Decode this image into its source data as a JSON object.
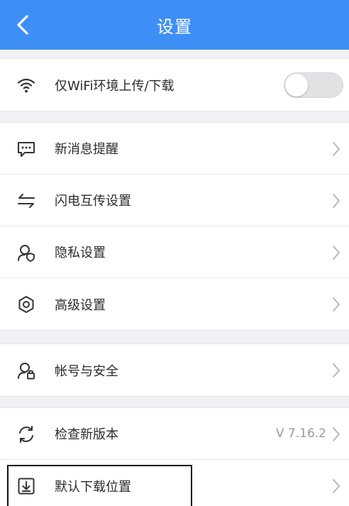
{
  "header": {
    "title": "设置",
    "back_icon": "chevron-left-icon",
    "color": "#3e8ff5"
  },
  "wifi": {
    "label": "仅WiFi环境上传/下载",
    "icon": "wifi-icon",
    "toggle_on": false
  },
  "group2": [
    {
      "label": "新消息提醒",
      "icon": "message-icon"
    },
    {
      "label": "闪电互传设置",
      "icon": "transfer-arrows-icon"
    },
    {
      "label": "隐私设置",
      "icon": "privacy-icon"
    },
    {
      "label": "高级设置",
      "icon": "gear-icon"
    }
  ],
  "account": {
    "label": "帐号与安全",
    "icon": "user-lock-icon"
  },
  "group4": [
    {
      "label": "检查新版本",
      "icon": "refresh-icon",
      "value": "V 7.16.2"
    },
    {
      "label": "默认下载位置",
      "icon": "download-icon"
    }
  ]
}
